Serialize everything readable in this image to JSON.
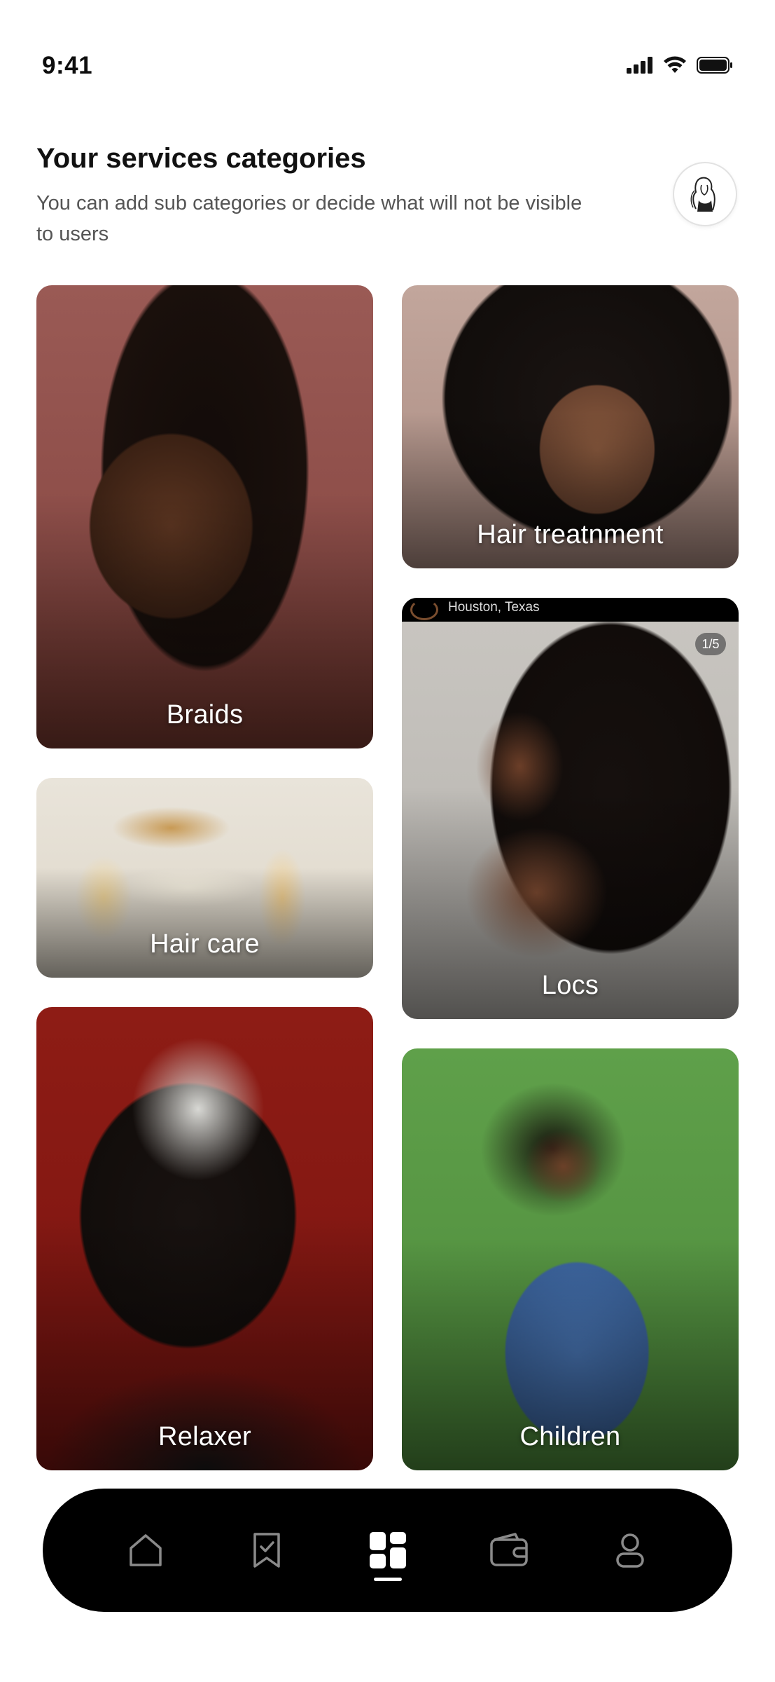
{
  "status_bar": {
    "time": "9:41"
  },
  "header": {
    "title": "Your services categories",
    "subtitle": "You can add sub categories or decide what will not be visible to users"
  },
  "categories": {
    "braids": "Braids",
    "hair_care": "Hair care",
    "relaxer": "Relaxer",
    "hair_treatment": "Hair treatnment",
    "locs": "Locs",
    "children": "Children"
  },
  "locs_overlay": {
    "location": "Houston, Texas",
    "counter": "1/5"
  },
  "bottom_nav": {
    "items": [
      "home",
      "bookings",
      "categories",
      "wallet",
      "profile"
    ],
    "active": "categories"
  },
  "colors": {
    "nav_background": "#000000",
    "nav_icon": "#8a8a8a",
    "nav_active": "#ffffff"
  }
}
